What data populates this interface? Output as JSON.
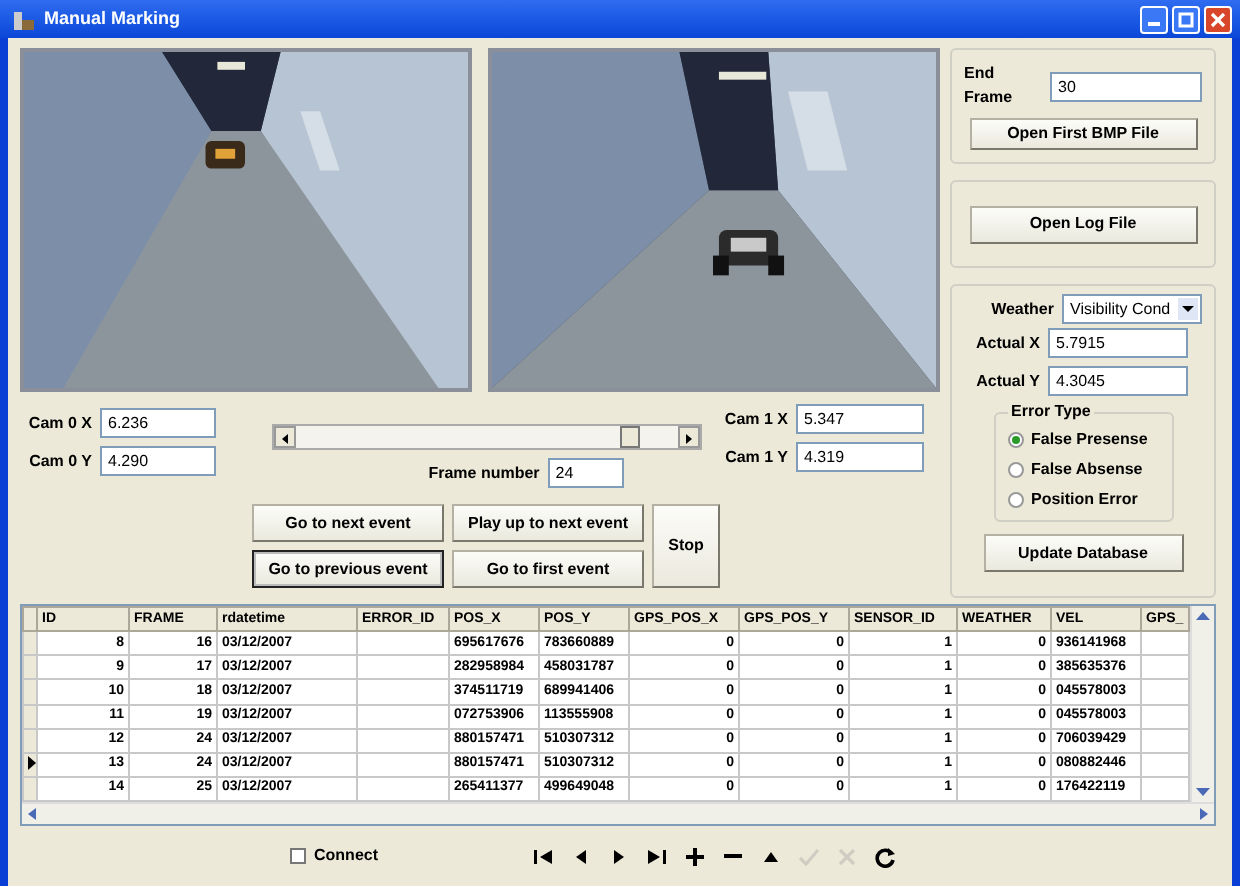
{
  "window": {
    "title": "Manual Marking"
  },
  "cam0": [
    {
      "label": "Cam 0 X",
      "value": "6.236"
    },
    {
      "label": "Cam 0 Y",
      "value": "4.290"
    }
  ],
  "cam1": [
    {
      "label": "Cam 1 X",
      "value": "5.347"
    },
    {
      "label": "Cam 1 Y",
      "value": "4.319"
    }
  ],
  "frame_slider": {
    "level": 0.9
  },
  "frame_number": {
    "label": "Frame number",
    "value": "24"
  },
  "event_buttons": [
    {
      "label": "Go to next event",
      "focused": false
    },
    {
      "label": "Play up to next event",
      "focused": false
    },
    {
      "label": "Go to previous event",
      "focused": true
    },
    {
      "label": "Go to first event",
      "focused": false
    }
  ],
  "stop_button": "Stop",
  "end_frame": {
    "label": "End Frame",
    "value": "30"
  },
  "open_bmp_button": "Open First BMP File",
  "open_log_button": "Open Log File",
  "weather": {
    "label": "Weather",
    "value": "Visibility Cond"
  },
  "actual": [
    {
      "label": "Actual X",
      "value": "5.7915"
    },
    {
      "label": "Actual Y",
      "value": "4.3045"
    }
  ],
  "error_type": {
    "legend": "Error Type",
    "options": [
      {
        "label": "False Presense",
        "selected": true
      },
      {
        "label": "False Absense",
        "selected": false
      },
      {
        "label": "Position Error",
        "selected": false
      }
    ]
  },
  "update_button": "Update Database",
  "table": {
    "columns": [
      {
        "label": "ID"
      },
      {
        "label": "FRAME"
      },
      {
        "label": "rdatetime"
      },
      {
        "label": "ERROR_ID"
      },
      {
        "label": "POS_X"
      },
      {
        "label": "POS_Y"
      },
      {
        "label": "GPS_POS_X"
      },
      {
        "label": "GPS_POS_Y"
      },
      {
        "label": "SENSOR_ID"
      },
      {
        "label": "WEATHER"
      },
      {
        "label": "VEL"
      },
      {
        "label": "GPS_"
      }
    ],
    "rows": [
      {
        "current": false,
        "cells": [
          "8",
          "16",
          "03/12/2007",
          "",
          "695617676",
          "783660889",
          "0",
          "0",
          "1",
          "0",
          "936141968",
          ""
        ]
      },
      {
        "current": false,
        "cells": [
          "9",
          "17",
          "03/12/2007",
          "",
          "282958984",
          "458031787",
          "0",
          "0",
          "1",
          "0",
          "385635376",
          ""
        ]
      },
      {
        "current": false,
        "cells": [
          "10",
          "18",
          "03/12/2007",
          "",
          "374511719",
          "689941406",
          "0",
          "0",
          "1",
          "0",
          "045578003",
          ""
        ]
      },
      {
        "current": false,
        "cells": [
          "11",
          "19",
          "03/12/2007",
          "",
          "072753906",
          "113555908",
          "0",
          "0",
          "1",
          "0",
          "045578003",
          ""
        ]
      },
      {
        "current": false,
        "cells": [
          "12",
          "24",
          "03/12/2007",
          "",
          "880157471",
          "510307312",
          "0",
          "0",
          "1",
          "0",
          "706039429",
          ""
        ]
      },
      {
        "current": true,
        "cells": [
          "13",
          "24",
          "03/12/2007",
          "",
          "880157471",
          "510307312",
          "0",
          "0",
          "1",
          "0",
          "080882446",
          ""
        ]
      },
      {
        "current": false,
        "cells": [
          "14",
          "25",
          "03/12/2007",
          "",
          "265411377",
          "499649048",
          "0",
          "0",
          "1",
          "0",
          "176422119",
          ""
        ]
      }
    ]
  },
  "connect": {
    "label": "Connect",
    "checked": false
  },
  "navigator": [
    {
      "kind": "first",
      "disabled": false
    },
    {
      "kind": "prior",
      "disabled": false
    },
    {
      "kind": "next",
      "disabled": false
    },
    {
      "kind": "last",
      "disabled": false
    },
    {
      "kind": "insert",
      "disabled": false
    },
    {
      "kind": "delete",
      "disabled": false
    },
    {
      "kind": "edit",
      "disabled": false
    },
    {
      "kind": "post",
      "disabled": true
    },
    {
      "kind": "cancel",
      "disabled": true
    },
    {
      "kind": "refresh",
      "disabled": false
    }
  ]
}
